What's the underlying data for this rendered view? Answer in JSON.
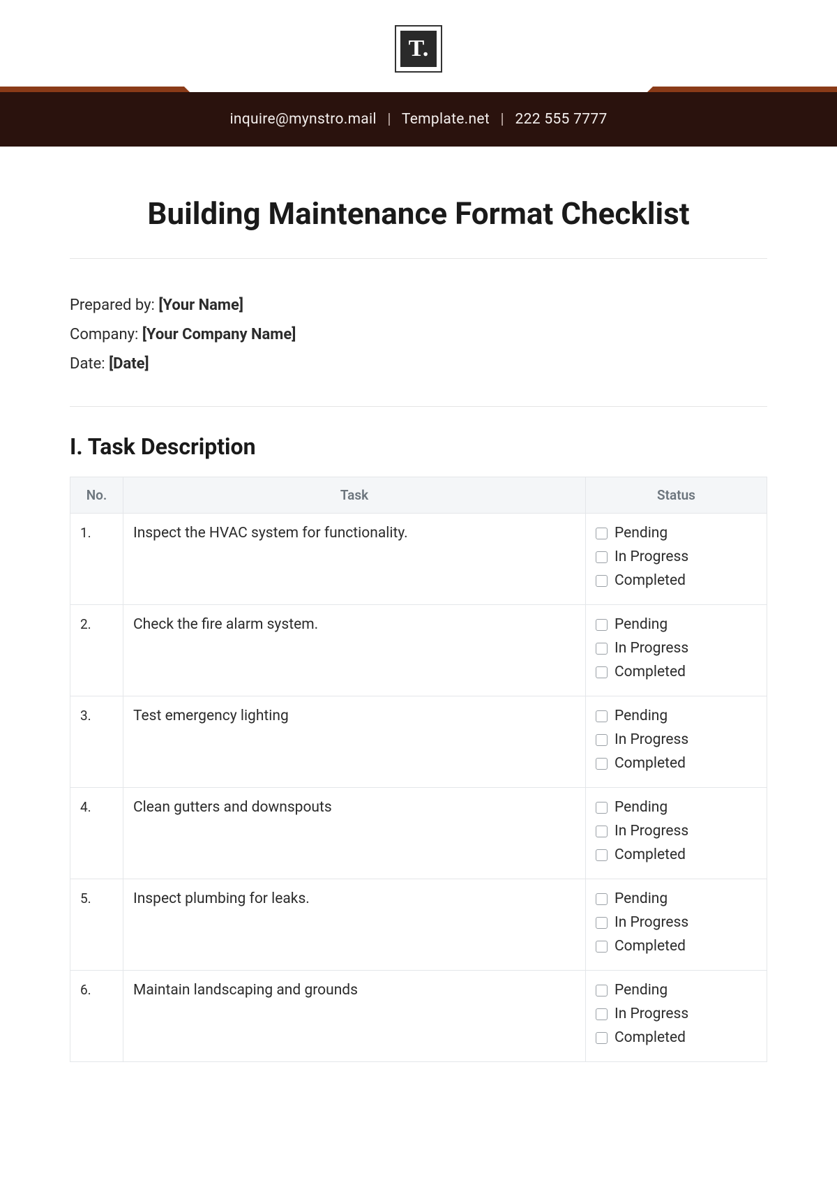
{
  "logo_text": "T.",
  "banner": {
    "email": "inquire@mynstro.mail",
    "site": "Template.net",
    "phone": "222 555 7777"
  },
  "title": "Building Maintenance Format Checklist",
  "meta": {
    "prepared_label": "Prepared by: ",
    "prepared_value": "[Your Name]",
    "company_label": "Company: ",
    "company_value": "[Your Company Name]",
    "date_label": "Date: ",
    "date_value": "[Date]"
  },
  "section1_heading": "I. Task Description",
  "table": {
    "head_no": "No.",
    "head_task": "Task",
    "head_status": "Status"
  },
  "status_options": {
    "pending": "Pending",
    "in_progress": "In Progress",
    "completed": "Completed"
  },
  "tasks": [
    {
      "no": "1.",
      "desc": "Inspect the HVAC system for functionality."
    },
    {
      "no": "2.",
      "desc": "Check the fire alarm system."
    },
    {
      "no": "3.",
      "desc": "Test emergency lighting"
    },
    {
      "no": "4.",
      "desc": "Clean gutters and downspouts"
    },
    {
      "no": "5.",
      "desc": "Inspect plumbing for leaks."
    },
    {
      "no": "6.",
      "desc": "Maintain landscaping and grounds"
    }
  ]
}
